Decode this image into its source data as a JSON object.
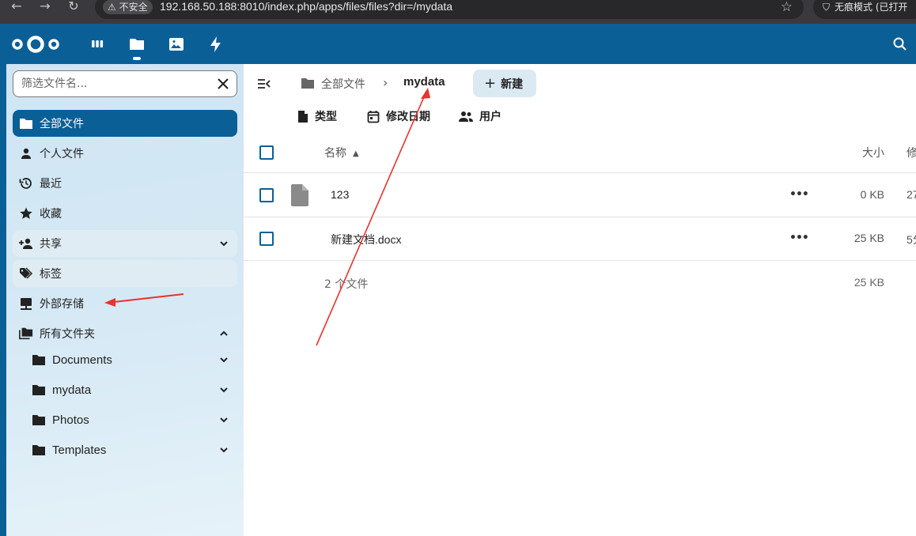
{
  "browser": {
    "security_label": "不安全",
    "url": "192.168.50.188:8010/index.php/apps/files/files?dir=/mydata",
    "incognito_label": "无痕模式 (已打开"
  },
  "sidebar": {
    "filter_placeholder": "筛选文件名...",
    "items": [
      {
        "label": "全部文件",
        "icon": "folder-icon"
      },
      {
        "label": "个人文件",
        "icon": "account-icon"
      },
      {
        "label": "最近",
        "icon": "history-icon"
      },
      {
        "label": "收藏",
        "icon": "star-icon"
      },
      {
        "label": "共享",
        "icon": "share-icon"
      },
      {
        "label": "标签",
        "icon": "tag-icon"
      },
      {
        "label": "外部存储",
        "icon": "network-storage-icon"
      },
      {
        "label": "所有文件夹",
        "icon": "folder-multiple-icon"
      }
    ],
    "folders": [
      {
        "label": "Documents"
      },
      {
        "label": "mydata"
      },
      {
        "label": "Photos"
      },
      {
        "label": "Templates"
      }
    ]
  },
  "breadcrumb": {
    "home": "全部文件",
    "current": "mydata",
    "new_label": "新建"
  },
  "filters": {
    "type": "类型",
    "modified": "修改日期",
    "people": "用户"
  },
  "table": {
    "col_name": "名称",
    "col_size": "大小",
    "col_modified": "修",
    "rows": [
      {
        "name": "123",
        "size": "0 KB",
        "modified": "27"
      },
      {
        "name": "新建文档.docx",
        "size": "25 KB",
        "modified": "5分"
      }
    ],
    "summary_count": "2 个文件",
    "summary_size": "25 KB"
  },
  "colors": {
    "brand": "#0b5f97",
    "annotation": "#e8332e"
  }
}
